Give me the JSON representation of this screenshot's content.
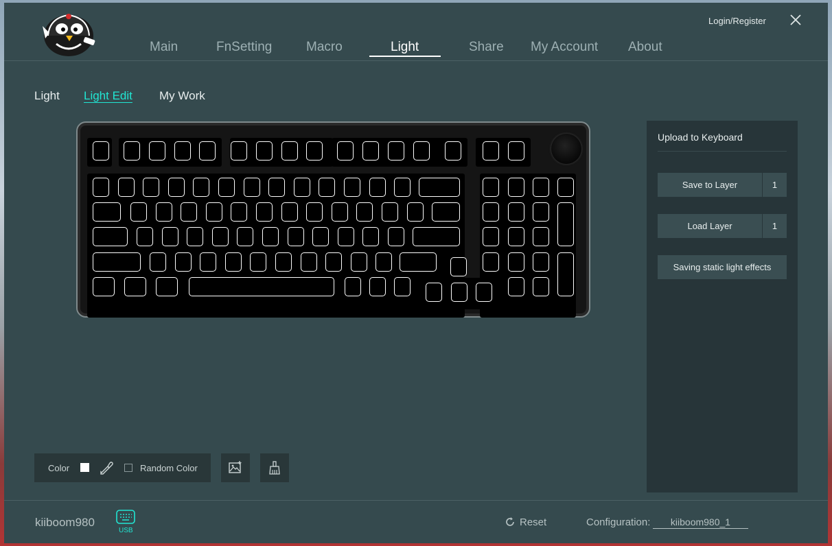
{
  "header": {
    "nav": [
      {
        "label": "Main"
      },
      {
        "label": "FnSetting"
      },
      {
        "label": "Macro"
      },
      {
        "label": "Light",
        "active": true
      },
      {
        "label": "Share"
      },
      {
        "label": "My Account"
      },
      {
        "label": "About"
      }
    ],
    "login_label": "Login/Register"
  },
  "subtabs": [
    {
      "label": "Light"
    },
    {
      "label": "Light Edit",
      "active": true
    },
    {
      "label": "My Work"
    }
  ],
  "side_panel": {
    "title": "Upload to Keyboard",
    "save_label": "Save to Layer",
    "save_layer": "1",
    "load_label": "Load Layer",
    "load_layer": "1",
    "static_label": "Saving static light effects"
  },
  "toolbar": {
    "color_label": "Color",
    "selected_color": "#ffffff",
    "random_label": "Random Color",
    "random_checked": false
  },
  "footer": {
    "device_name": "kiiboom980",
    "usb_label": "USB",
    "reset_label": "Reset",
    "config_label": "Configuration:",
    "config_value": "kiiboom980_1"
  },
  "colors": {
    "background": "#354a4e",
    "accent": "#21e6d3",
    "panel": "#273539"
  }
}
